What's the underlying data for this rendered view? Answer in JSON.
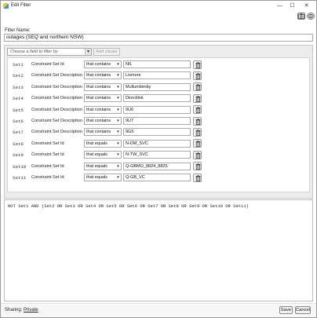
{
  "window": {
    "title": "Edit Filter",
    "minimize_glyph": "—",
    "maximize_glyph": "☐",
    "close_glyph": "✕"
  },
  "toolbar": {
    "camera_icon": "camera-icon",
    "settings_icon": "gear-icon"
  },
  "filter_name": {
    "label": "Filter Name:",
    "value": "outages (SEQ and northern NSW)"
  },
  "clause_builder": {
    "field_placeholder": "Choose a field to filter by",
    "add_clause_label": "Add clause"
  },
  "rows": [
    {
      "set": "Set1",
      "field": "Constraint Set Id",
      "operator": "that contains",
      "value": "NIL"
    },
    {
      "set": "Set2",
      "field": "Constraint Set Description",
      "operator": "that contains",
      "value": "Lismore"
    },
    {
      "set": "Set3",
      "field": "Constraint Set Description",
      "operator": "that contains",
      "value": "Mullumbimby"
    },
    {
      "set": "Set4",
      "field": "Constraint Set Description",
      "operator": "that contains",
      "value": "Directlink"
    },
    {
      "set": "Set5",
      "field": "Constraint Set Description",
      "operator": "that contains",
      "value": "9U6"
    },
    {
      "set": "Set6",
      "field": "Constraint Set Description",
      "operator": "that contains",
      "value": "9U7"
    },
    {
      "set": "Set7",
      "field": "Constraint Set Description",
      "operator": "that contains",
      "value": "9G5"
    },
    {
      "set": "Set8",
      "field": "Constraint Set Id",
      "operator": "that equals",
      "value": "N-DM_SVC"
    },
    {
      "set": "Set9",
      "field": "Constraint Set Id",
      "operator": "that equals",
      "value": "N-TW_SVC"
    },
    {
      "set": "Set10",
      "field": "Constraint Set Id",
      "operator": "that equals",
      "value": "Q-GBMO_8824_8825"
    },
    {
      "set": "Set11",
      "field": "Constraint Set Id",
      "operator": "that equals",
      "value": "Q-GB_VC"
    }
  ],
  "expression": "NOT Set1 AND (Set2 OR Set3 OR Set4 OR Set5 OR Set6 OR Set7 OR Set8 OR Set9 OR Set10 OR Set11)",
  "footer": {
    "sharing_label": "Sharing:",
    "sharing_value": "Private",
    "save_label": "Save",
    "cancel_label": "Cancel"
  }
}
